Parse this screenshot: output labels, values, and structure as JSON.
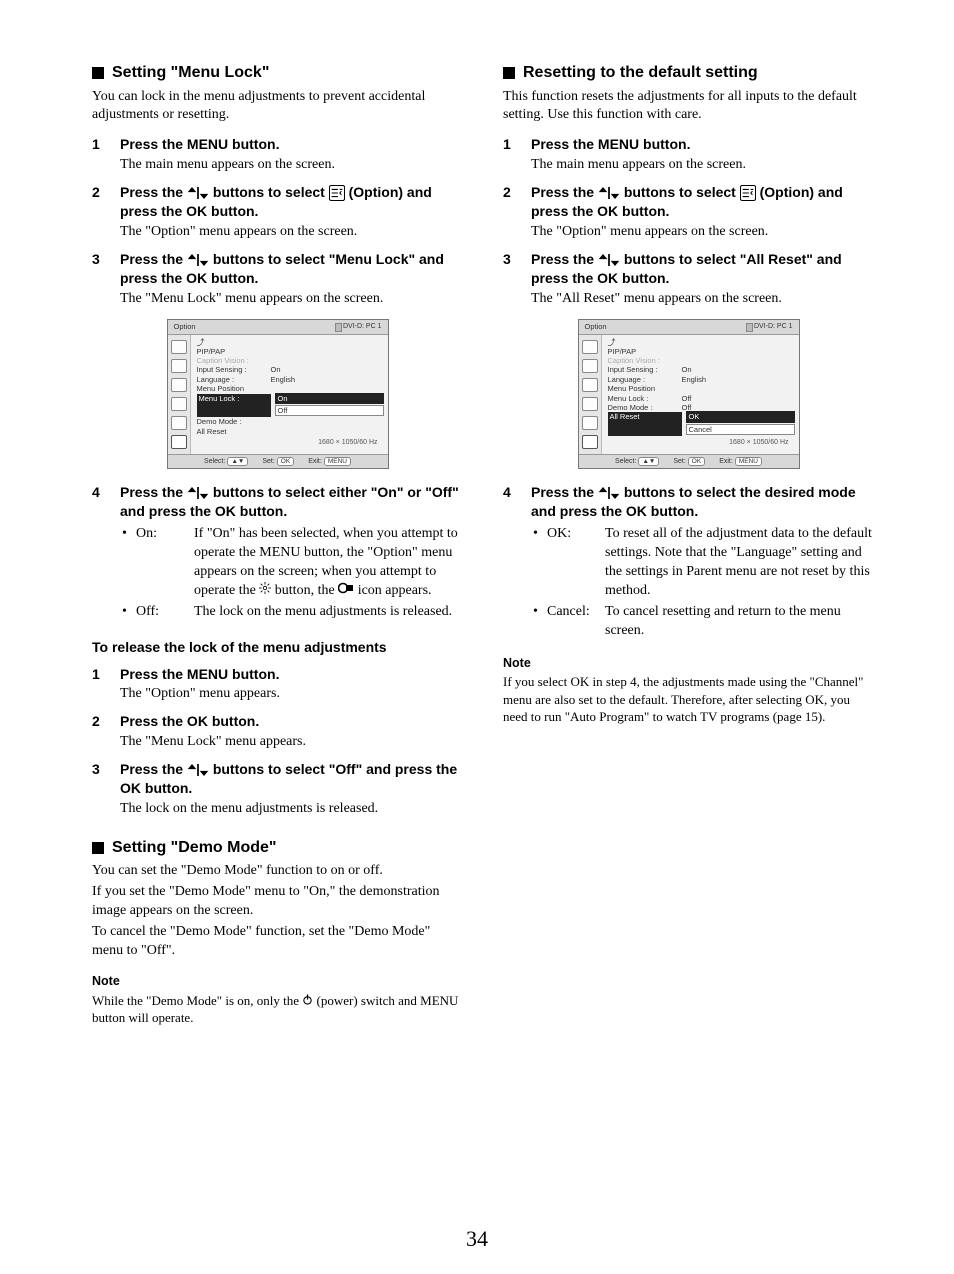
{
  "pageNumber": "34",
  "left": {
    "menuLock": {
      "title": "Setting \"Menu Lock\"",
      "intro": "You can lock in the menu adjustments to prevent accidental adjustments or resetting.",
      "steps": [
        {
          "num": "1",
          "head": "Press the MENU button.",
          "desc": "The main menu appears on the screen."
        },
        {
          "num": "2",
          "head_before": "Press the ",
          "head_mid": " buttons to select ",
          "head_after": " (Option) and press the OK button.",
          "desc": "The \"Option\" menu appears on the screen."
        },
        {
          "num": "3",
          "head_before": "Press the ",
          "head_after": " buttons to select \"Menu Lock\" and press the OK button.",
          "desc": "The \"Menu Lock\" menu appears on the screen."
        }
      ],
      "osd": {
        "title": "Option",
        "src": "DVI-D: PC 1",
        "rows": [
          {
            "k": "PIP/PAP",
            "v": ""
          },
          {
            "k": "Caption Vision :",
            "v": "",
            "dim": true
          },
          {
            "k": "Input Sensing :",
            "v": "On"
          },
          {
            "k": "Language :",
            "v": "English"
          },
          {
            "k": "Menu Position",
            "v": ""
          },
          {
            "k": "Menu Lock :",
            "v": "",
            "active": true
          },
          {
            "k": "Demo Mode :",
            "v": ""
          },
          {
            "k": "All Reset",
            "v": ""
          }
        ],
        "popup": [
          {
            "label": "On",
            "sel": true
          },
          {
            "label": "Off"
          }
        ],
        "res": "1680 × 1050/60 Hz",
        "foot": {
          "select": "Select:",
          "set": "Set:",
          "setBtn": "OK",
          "exit": "Exit:",
          "exitBtn": "MENU"
        }
      },
      "step4": {
        "num": "4",
        "head_before": "Press the ",
        "head_after": " buttons to select either \"On\" or \"Off\" and press the OK button.",
        "bullets": [
          {
            "label": "On:",
            "txt": "If \"On\" has been selected, when you attempt to operate the MENU button, the \"Option\" menu appears on the screen; when you attempt to operate the        button, the        icon appears."
          },
          {
            "label": "Off:",
            "txt": "The lock on the menu adjustments is released."
          }
        ]
      },
      "release": {
        "title": "To release the lock of the menu adjustments",
        "steps": [
          {
            "num": "1",
            "head": "Press the MENU button.",
            "desc": "The \"Option\" menu appears."
          },
          {
            "num": "2",
            "head": "Press the OK button.",
            "desc": "The \"Menu Lock\" menu appears."
          },
          {
            "num": "3",
            "head_before": "Press the ",
            "head_after": " buttons to select \"Off\" and press the OK button.",
            "desc": "The lock on the menu adjustments is released."
          }
        ]
      }
    },
    "demoMode": {
      "title": "Setting \"Demo Mode\"",
      "p1": "You can set the \"Demo Mode\" function to on or off.",
      "p2": "If you set the \"Demo Mode\" menu to \"On,\" the demonstration image appears on the screen.",
      "p3": "To cancel  the \"Demo Mode\" function, set the \"Demo Mode\" menu to \"Off\".",
      "noteHead": "Note",
      "noteBody_before": "While the \"Demo Mode\" is on, only the ",
      "noteBody_after": " (power) switch and MENU button will operate."
    }
  },
  "right": {
    "reset": {
      "title": "Resetting to the default setting",
      "intro": "This function resets the adjustments for all inputs to the default setting. Use this function with care.",
      "steps": [
        {
          "num": "1",
          "head": "Press the MENU button.",
          "desc": "The main menu appears on the screen."
        },
        {
          "num": "2",
          "head_before": "Press the ",
          "head_mid": " buttons to select ",
          "head_after": " (Option) and press the OK button.",
          "desc": "The \"Option\" menu appears on the screen."
        },
        {
          "num": "3",
          "head_before": "Press the ",
          "head_after": " buttons to select \"All Reset\" and press the OK button.",
          "desc": "The \"All Reset\" menu appears on the screen."
        }
      ],
      "osd": {
        "title": "Option",
        "src": "DVI-D: PC 1",
        "rows": [
          {
            "k": "PIP/PAP",
            "v": ""
          },
          {
            "k": "Caption Vision :",
            "v": "",
            "dim": true
          },
          {
            "k": "Input Sensing :",
            "v": "On"
          },
          {
            "k": "Language :",
            "v": "English"
          },
          {
            "k": "Menu Position",
            "v": ""
          },
          {
            "k": "Menu Lock :",
            "v": "Off"
          },
          {
            "k": "Demo Mode :",
            "v": "Off"
          },
          {
            "k": "All Reset",
            "v": "",
            "active": true
          }
        ],
        "popup": [
          {
            "label": "OK",
            "sel": true
          },
          {
            "label": "Cancel"
          }
        ],
        "res": "1680 × 1050/60 Hz",
        "foot": {
          "select": "Select:",
          "set": "Set:",
          "setBtn": "OK",
          "exit": "Exit:",
          "exitBtn": "MENU"
        }
      },
      "step4": {
        "num": "4",
        "head_before": "Press the ",
        "head_after": " buttons to select the desired mode and press the OK button.",
        "bullets": [
          {
            "label": "OK:",
            "txt": "To reset all of the adjustment data to the default settings. Note that the \"Language\" setting and the settings in Parent menu are not reset by this method."
          },
          {
            "label": "Cancel:",
            "txt": "To cancel resetting and return to the menu screen."
          }
        ]
      },
      "noteHead": "Note",
      "noteBody": "If you select OK in step 4, the adjustments made using the \"Channel\" menu are also set to the default. Therefore, after selecting OK, you need to run \"Auto Program\" to watch TV programs (page 15)."
    }
  }
}
